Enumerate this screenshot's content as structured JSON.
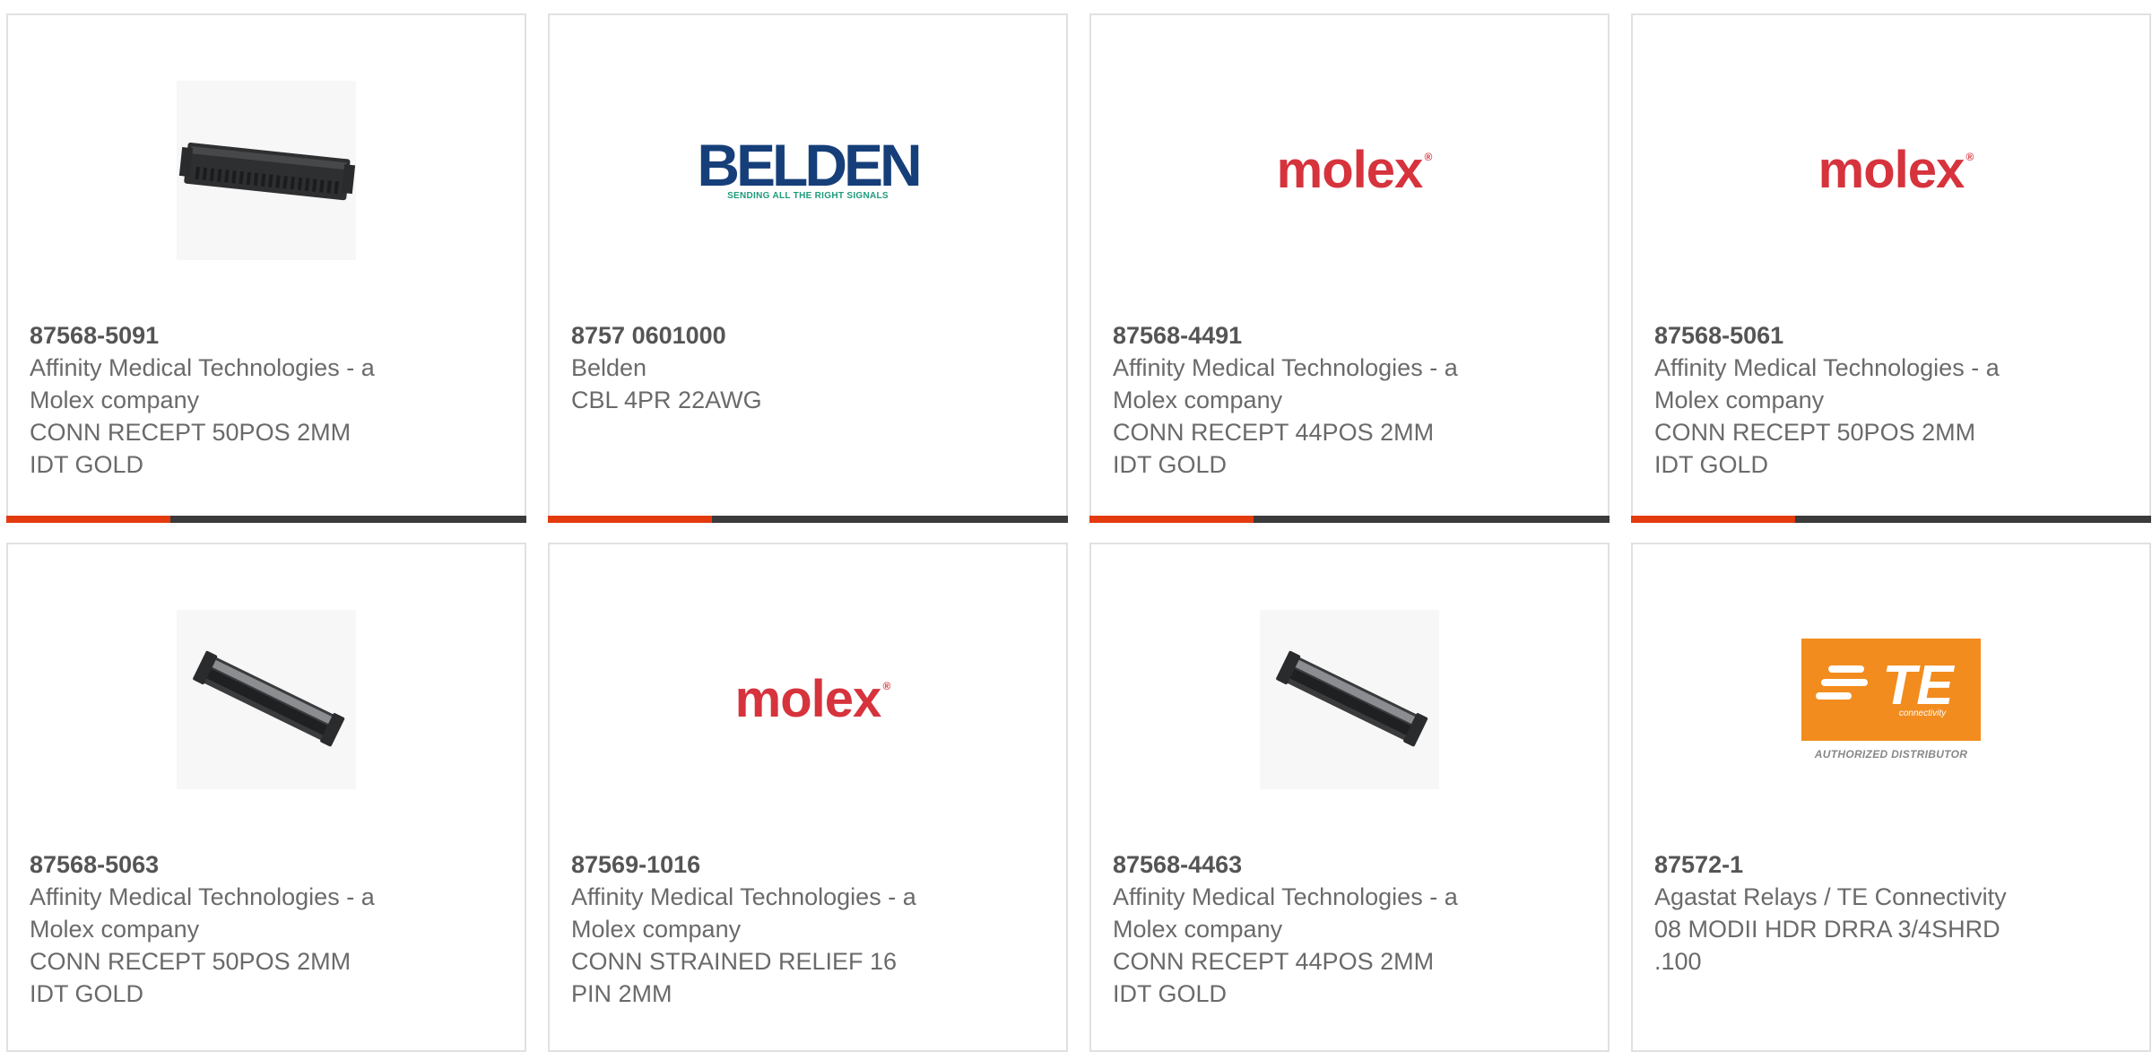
{
  "products": [
    {
      "part_number": "87568-5091",
      "manufacturer_line1": "Affinity Medical Technologies - a",
      "manufacturer_line2": "Molex company",
      "description_line1": "CONN RECEPT 50POS 2MM",
      "description_line2": "IDT GOLD",
      "image": "connector-photo-horizontal",
      "show_bar": true
    },
    {
      "part_number": "8757 0601000",
      "manufacturer_line1": "Belden",
      "manufacturer_line2": "",
      "description_line1": "CBL 4PR 22AWG",
      "description_line2": "",
      "image": "belden-logo",
      "logo_text": "BELDEN",
      "logo_tagline": "SENDING ALL THE RIGHT SIGNALS",
      "show_bar": true
    },
    {
      "part_number": "87568-4491",
      "manufacturer_line1": "Affinity Medical Technologies - a",
      "manufacturer_line2": "Molex company",
      "description_line1": "CONN RECEPT 44POS 2MM",
      "description_line2": "IDT GOLD",
      "image": "molex-logo",
      "logo_text": "molex",
      "show_bar": true
    },
    {
      "part_number": "87568-5061",
      "manufacturer_line1": "Affinity Medical Technologies - a",
      "manufacturer_line2": "Molex company",
      "description_line1": "CONN RECEPT 50POS 2MM",
      "description_line2": "IDT GOLD",
      "image": "molex-logo",
      "logo_text": "molex",
      "show_bar": true
    },
    {
      "part_number": "87568-5063",
      "manufacturer_line1": "Affinity Medical Technologies - a",
      "manufacturer_line2": "Molex company",
      "description_line1": "CONN RECEPT 50POS 2MM",
      "description_line2": "IDT GOLD",
      "image": "connector-photo-angled",
      "show_bar": false
    },
    {
      "part_number": "87569-1016",
      "manufacturer_line1": "Affinity Medical Technologies - a",
      "manufacturer_line2": "Molex company",
      "description_line1": "CONN STRAINED RELIEF 16",
      "description_line2": "PIN 2MM",
      "image": "molex-logo",
      "logo_text": "molex",
      "show_bar": false
    },
    {
      "part_number": "87568-4463",
      "manufacturer_line1": "Affinity Medical Technologies - a",
      "manufacturer_line2": "Molex company",
      "description_line1": "CONN RECEPT 44POS 2MM",
      "description_line2": "IDT GOLD",
      "image": "connector-photo-angled",
      "show_bar": false
    },
    {
      "part_number": "87572-1",
      "manufacturer_line1": "Agastat Relays / TE Connectivity",
      "manufacturer_line2": "",
      "description_line1": "08 MODII HDR DRRA 3/4SHRD",
      "description_line2": ".100",
      "image": "te-logo",
      "logo_text": "TE",
      "logo_subtext": "connectivity",
      "logo_caption": "AUTHORIZED DISTRIBUTOR",
      "show_bar": false
    }
  ],
  "colors": {
    "accent": "#e33b0e",
    "bar_dark": "#3b3b3b",
    "molex_red": "#d6333d",
    "belden_blue": "#163f7a",
    "te_orange": "#f28c1e",
    "text_gray": "#6a6a6a"
  }
}
